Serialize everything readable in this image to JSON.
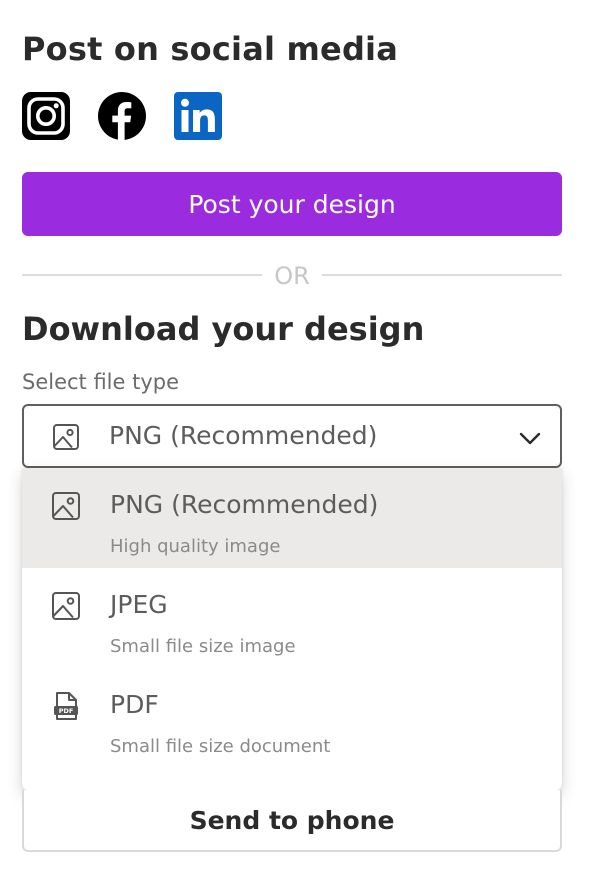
{
  "social": {
    "title": "Post on social media",
    "icons": [
      "instagram-icon",
      "facebook-icon",
      "linkedin-icon"
    ],
    "post_button": "Post your design"
  },
  "divider": {
    "text": "OR"
  },
  "download": {
    "title": "Download your design",
    "file_type_label": "Select file type",
    "selected_value": "PNG (Recommended)",
    "options": [
      {
        "label": "PNG (Recommended)",
        "desc": "High quality image",
        "icon": "image-icon",
        "selected": true
      },
      {
        "label": "JPEG",
        "desc": "Small file size image",
        "icon": "image-icon",
        "selected": false
      },
      {
        "label": "PDF",
        "desc": "Small file size document",
        "icon": "pdf-file-icon",
        "selected": false
      }
    ],
    "send_button": "Send to phone"
  },
  "colors": {
    "primary": "#9b2bdf",
    "linkedin": "#0a66c2",
    "selected_row": "#ebeae8"
  }
}
